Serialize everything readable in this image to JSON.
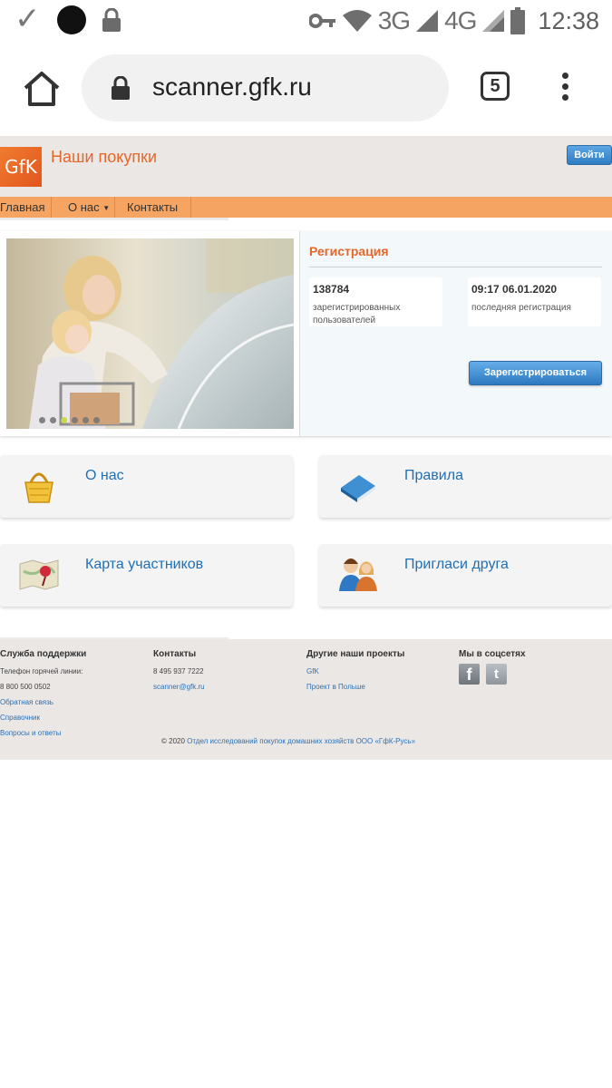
{
  "status_bar": {
    "network_3g": "3G",
    "network_4g": "4G",
    "time": "12:38"
  },
  "browser": {
    "url": "scanner.gfk.ru",
    "tab_count": "5"
  },
  "site": {
    "logo_text": "GfK",
    "title": "Наши покупки",
    "login_label": "Войти",
    "nav": {
      "home": "Главная",
      "about": "О нас",
      "contacts": "Контакты"
    }
  },
  "registration": {
    "title": "Регистрация",
    "registered_count": "138784",
    "registered_label": "зарегистрированных пользователей",
    "last_registration": "09:17 06.01.2020",
    "last_registration_label": "последняя регистрация",
    "register_button": "Зарегистрироваться",
    "slides_total": 6,
    "slides_active": 3
  },
  "cards": {
    "about": "О нас",
    "rules": "Правила",
    "map": "Карта участников",
    "invite": "Пригласи друга"
  },
  "footer": {
    "support": {
      "heading": "Служба поддержки",
      "hotline_label": "Телефон горячей линии:",
      "hotline": "8 800 500 0502",
      "feedback": "Обратная связь",
      "reference": "Справочник",
      "faq": "Вопросы и ответы"
    },
    "contacts": {
      "heading": "Контакты",
      "phone": "8 495 937 7222",
      "email": "scanner@gfk.ru"
    },
    "projects": {
      "heading": "Другие наши проекты",
      "gfk": "GfK",
      "poland": "Проект в Польше"
    },
    "social": {
      "heading": "Мы в соцсетях",
      "facebook": "f",
      "twitter": "t"
    },
    "copyright_prefix": "© 2020",
    "copyright_link": "Отдел исследований покупок домашних хозяйств ООО «ГфК-Русь»"
  },
  "colors": {
    "accent_orange": "#e6672a",
    "nav_orange": "#f5a461",
    "link_blue": "#1f6fb4",
    "button_blue": "#2f7cc1"
  }
}
